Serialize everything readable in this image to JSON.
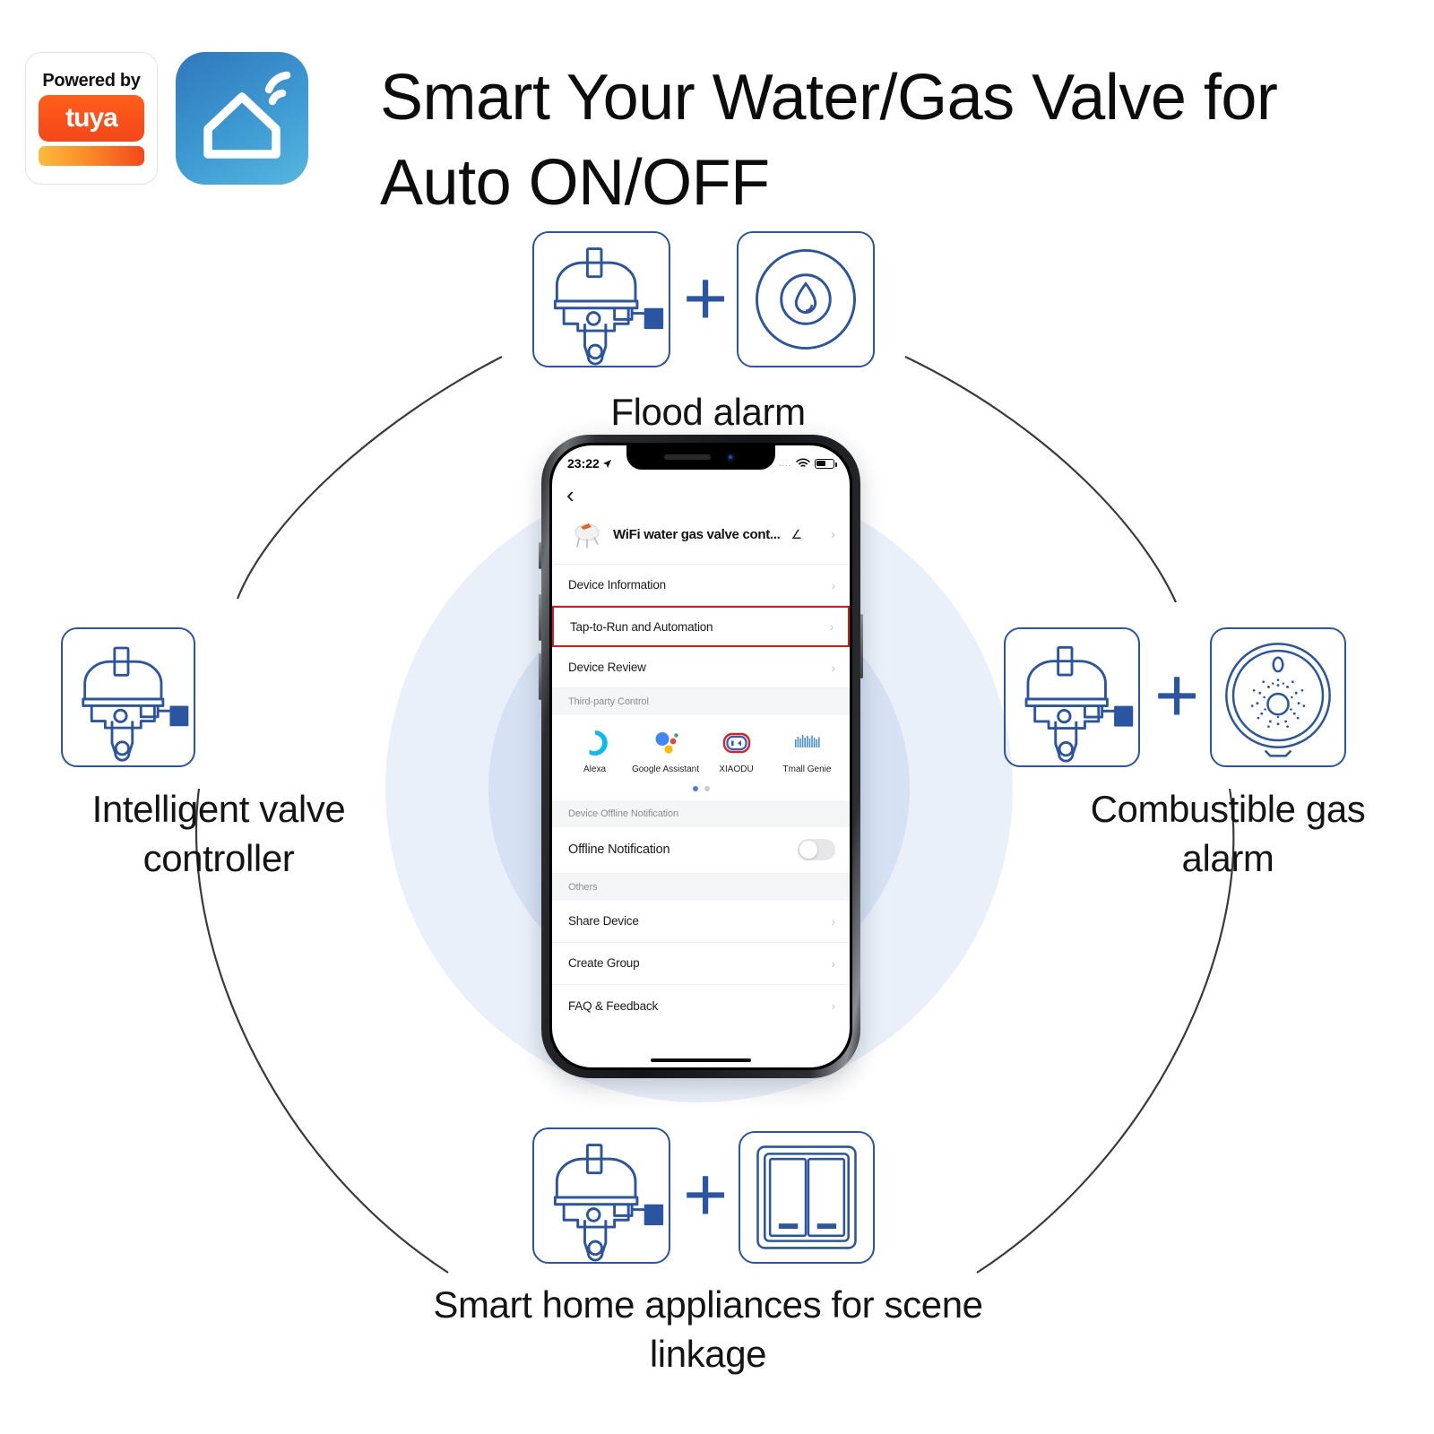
{
  "header": {
    "tuya_badge": {
      "powered_by": "Powered by",
      "brand": "tuya",
      "icon": "tuya-wifi-icon"
    },
    "smart_life_icon": "smart-home-wifi-icon",
    "title": "Smart Your Water/Gas Valve for Auto ON/OFF"
  },
  "colors": {
    "brand_blue": "#2b55a0",
    "tuya_orange": "#f4471a",
    "highlight_red": "#cf1b22",
    "circle_outer": "#eaf0f9",
    "circle_inner": "#d6e2f3",
    "accent_blue": "#4a7fd4"
  },
  "nodes": [
    {
      "id": "flood",
      "caption": "Flood alarm",
      "icons": [
        "valve-controller-icon",
        "water-leak-sensor-icon"
      ],
      "connector": "plus"
    },
    {
      "id": "valve",
      "caption": "Intelligent valve controller",
      "icons": [
        "valve-controller-icon"
      ],
      "connector": ""
    },
    {
      "id": "gas",
      "caption": "Combustible gas alarm",
      "icons": [
        "valve-controller-icon",
        "gas-detector-icon"
      ],
      "connector": "plus"
    },
    {
      "id": "scene",
      "caption": "Smart home appliances for scene linkage",
      "icons": [
        "valve-controller-icon",
        "wall-switch-icon"
      ],
      "connector": "plus"
    }
  ],
  "phone": {
    "status_bar": {
      "time": "23:22",
      "location_icon": "location-arrow-icon",
      "signal_dots": "....",
      "wifi_icon": "wifi-icon",
      "battery_icon": "battery-icon"
    },
    "nav": {
      "back_icon": "chevron-left-icon"
    },
    "device": {
      "thumb_icon": "valve-device-photo",
      "name": "WiFi water gas valve cont...",
      "edit_icon": "pencil-icon",
      "chevron": "›"
    },
    "menu_rows": [
      {
        "label": "Device Information",
        "chevron": "›",
        "highlighted": false
      },
      {
        "label": "Tap-to-Run and Automation",
        "chevron": "›",
        "highlighted": true
      },
      {
        "label": "Device Review",
        "chevron": "›",
        "highlighted": false
      }
    ],
    "third_party": {
      "section_title": "Third-party Control",
      "items": [
        {
          "label": "Alexa",
          "icon": "alexa-icon"
        },
        {
          "label": "Google Assistant",
          "icon": "google-assistant-icon"
        },
        {
          "label": "XIAODU",
          "icon": "xiaodu-icon"
        },
        {
          "label": "Tmall Genie",
          "icon": "tmall-genie-icon"
        }
      ],
      "pager": {
        "pages": 2,
        "active": 1
      }
    },
    "offline": {
      "section_title": "Device Offline Notification",
      "row_label": "Offline Notification",
      "toggle_state": "off"
    },
    "others": {
      "section_title": "Others",
      "rows": [
        {
          "label": "Share Device",
          "chevron": "›"
        },
        {
          "label": "Create Group",
          "chevron": "›"
        },
        {
          "label": "FAQ & Feedback",
          "chevron": "›"
        }
      ]
    }
  }
}
